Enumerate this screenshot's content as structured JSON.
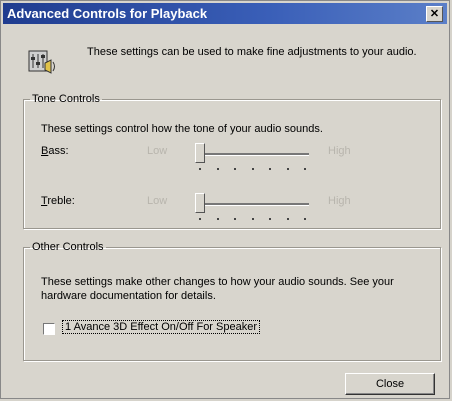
{
  "window": {
    "title": "Advanced Controls for Playback",
    "close_glyph": "✕"
  },
  "intro": {
    "text": "These settings can be used to make fine adjustments to your audio."
  },
  "tone_controls": {
    "legend": "Tone Controls",
    "description": "These settings control how the tone of your audio sounds.",
    "bass": {
      "label_underlined": "B",
      "label_rest": "ass:",
      "low": "Low",
      "high": "High",
      "level": 0.0
    },
    "treble": {
      "label_underlined": "T",
      "label_rest": "reble:",
      "low": "Low",
      "high": "High",
      "level": 0.0
    }
  },
  "other_controls": {
    "legend": "Other Controls",
    "description": "These settings make other changes to how your audio sounds.  See your hardware documentation for details.",
    "checkbox": {
      "label": "1  Avance 3D Effect On/Off For Speaker",
      "checked": false
    }
  },
  "buttons": {
    "close": "Close"
  }
}
